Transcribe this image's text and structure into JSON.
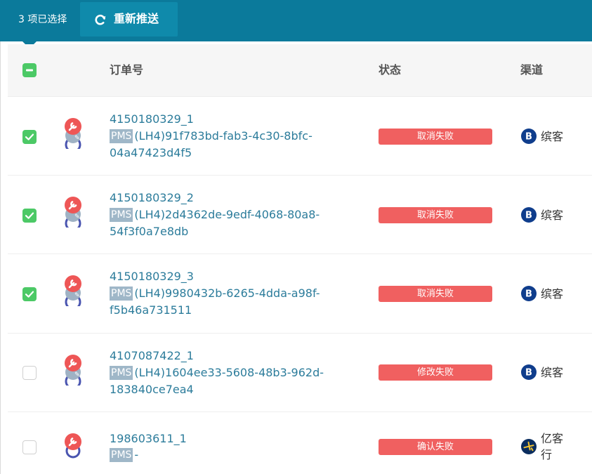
{
  "toolbar": {
    "selection_count": "3 项已选择",
    "repush_label": "重新推送"
  },
  "table": {
    "columns": {
      "order_no": "订单号",
      "status": "状态",
      "channel": "渠道"
    },
    "rows": [
      {
        "checked": true,
        "order_no": "4150180329_1",
        "pms_badge": "PMS",
        "pms_text": "(LH4)91f783bd-fab3-4c30-8bfc-04a47423d4f5",
        "status": "取消失败",
        "channel": "缤客",
        "channel_icon": "booking-b-icon"
      },
      {
        "checked": true,
        "order_no": "4150180329_2",
        "pms_badge": "PMS",
        "pms_text": "(LH4)2d4362de-9edf-4068-80a8-54f3f0a7e8db",
        "status": "取消失败",
        "channel": "缤客",
        "channel_icon": "booking-b-icon"
      },
      {
        "checked": true,
        "order_no": "4150180329_3",
        "pms_badge": "PMS",
        "pms_text": "(LH4)9980432b-6265-4dda-a98f-f5b46a731511",
        "status": "取消失败",
        "channel": "缤客",
        "channel_icon": "booking-b-icon"
      },
      {
        "checked": false,
        "order_no": "4107087422_1",
        "pms_badge": "PMS",
        "pms_text": "(LH4)1604ee33-5608-48b3-962d-183840ce7ea4",
        "status": "修改失败",
        "channel": "缤客",
        "channel_icon": "booking-b-icon"
      },
      {
        "checked": false,
        "order_no": "198603611_1",
        "pms_badge": "PMS",
        "pms_text": "-",
        "status": "确认失败",
        "channel": "亿客行",
        "channel_icon": "expedia-plane-icon"
      }
    ]
  },
  "colors": {
    "topbar": "#0b7a9b",
    "button": "#0f8aab",
    "checkbox_checked": "#4cc966",
    "status_error": "#f06060",
    "link": "#2c7c9b",
    "pms_badge": "#9fb7c8",
    "wrench_icon": "#ee5656",
    "ring_icon": "#4a55b0"
  }
}
